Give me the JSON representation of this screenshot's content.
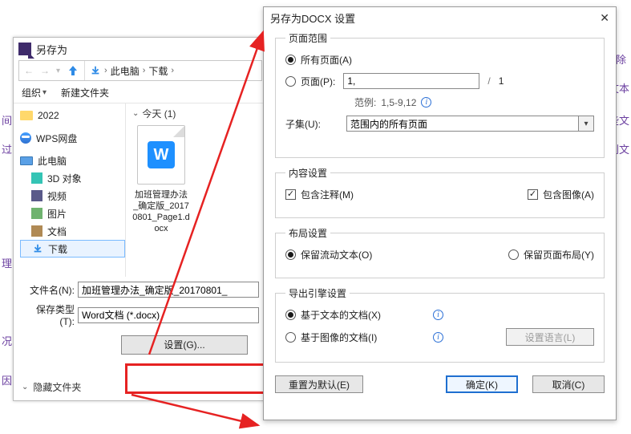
{
  "bg": {
    "t1": "间",
    "t2": "过",
    "t3": "理",
    "t4": "况,",
    "t5": "因",
    "t6": "除",
    "t7": "文本",
    "t8": "些文",
    "t9": "别文"
  },
  "save": {
    "title": "另存为",
    "path_pc": "此电脑",
    "path_dl": "下载",
    "organize": "组织",
    "newfolder": "新建文件夹",
    "tree": {
      "y2022": "2022",
      "wps": "WPS网盘",
      "pc": "此电脑",
      "d3d": "3D 对象",
      "video": "视频",
      "pic": "图片",
      "docs": "文档",
      "dl": "下载"
    },
    "today_header": "今天 (1)",
    "doc_name": "加班管理办法_确定版_20170801_Page1.docx",
    "filename_label": "文件名(N):",
    "filename_value": "加班管理办法_确定版_20170801_",
    "type_label": "保存类型(T):",
    "type_value": "Word文档 (*.docx)",
    "settings_btn": "设置(G)...",
    "hide_folders": "隐藏文件夹"
  },
  "cfg": {
    "title": "另存为DOCX 设置",
    "g_page": "页面范围",
    "all_pages": "所有页面(A)",
    "pages_label": "页面(P):",
    "pages_input": "1,",
    "pages_total": "1",
    "example_label": "范例:",
    "example_value": "1,5-9,12",
    "subset_label": "子集(U):",
    "subset_value": "范围内的所有页面",
    "g_content": "内容设置",
    "inc_notes": "包含注释(M)",
    "inc_images": "包含图像(A)",
    "g_layout": "布局设置",
    "layout_flow": "保留流动文本(O)",
    "layout_page": "保留页面布局(Y)",
    "g_engine": "导出引擎设置",
    "engine_text": "基于文本的文档(X)",
    "engine_image": "基于图像的文档(I)",
    "set_lang": "设置语言(L)",
    "reset": "重置为默认(E)",
    "ok": "确定(K)",
    "cancel": "取消(C)"
  }
}
